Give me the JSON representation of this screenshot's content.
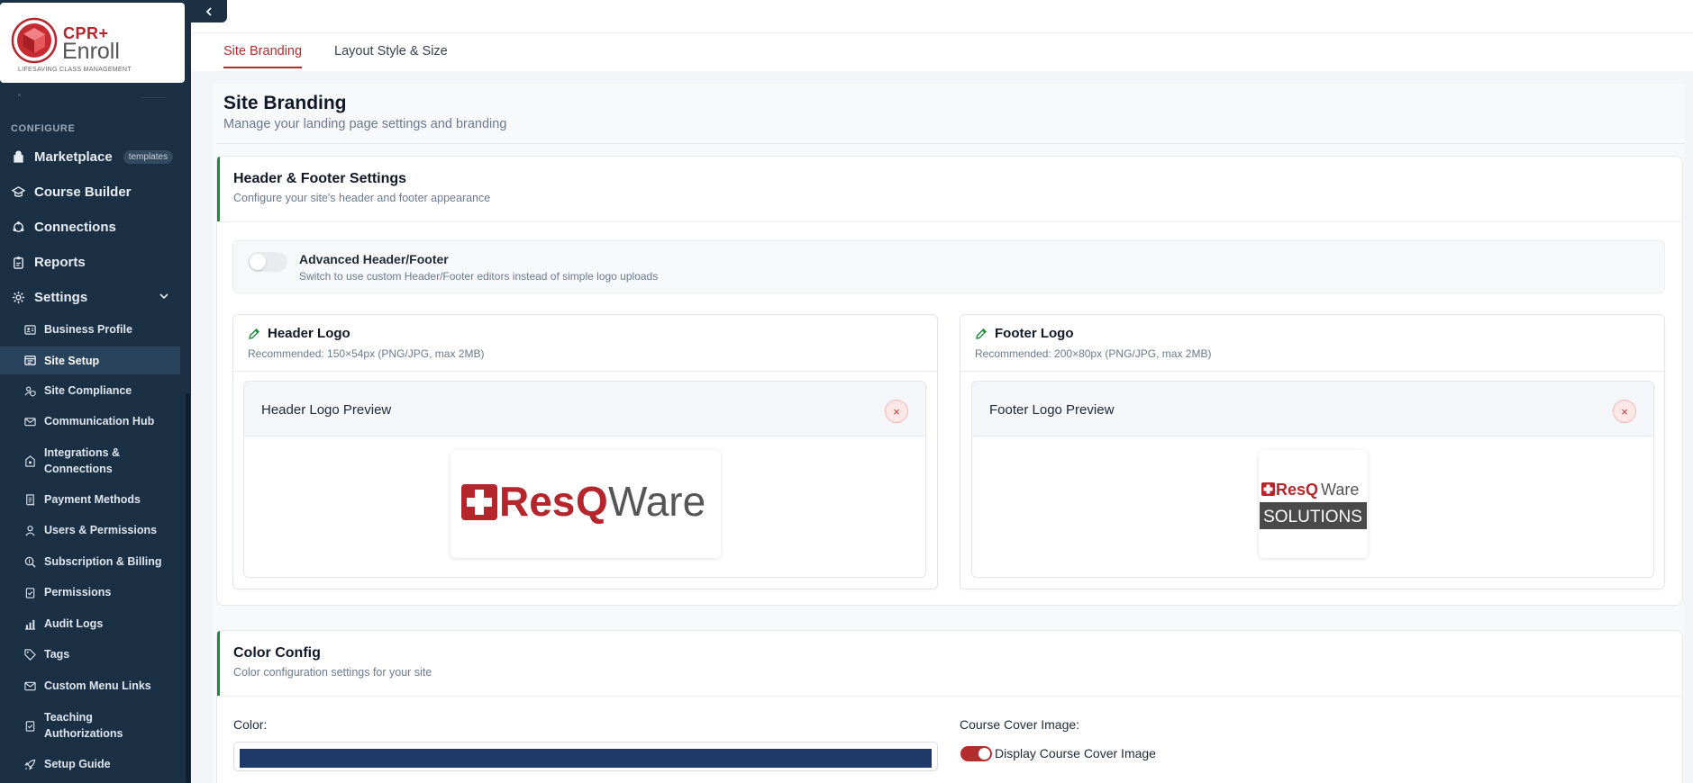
{
  "brand": {
    "name_top": "CPR+",
    "name_bottom": "Enroll",
    "tagline": "LIFESAVING CLASS MANAGEMENT"
  },
  "sidebar": {
    "section_label": "CONFIGURE",
    "top_items": [
      {
        "label": "Marketplace",
        "icon": "shop-icon",
        "badge": "templates"
      },
      {
        "label": "Course Builder",
        "icon": "graduation-cap-icon"
      },
      {
        "label": "Connections",
        "icon": "connections-icon"
      },
      {
        "label": "Reports",
        "icon": "clipboard-icon"
      },
      {
        "label": "Settings",
        "icon": "gear-icon"
      }
    ],
    "sub_items": [
      {
        "label": "Business Profile",
        "icon": "id-card-icon"
      },
      {
        "label": "Site Setup",
        "icon": "layout-icon"
      },
      {
        "label": "Site Compliance",
        "icon": "user-shield-icon"
      },
      {
        "label": "Communication Hub",
        "icon": "envelope-icon"
      },
      {
        "label": "Integrations & Connections",
        "icon": "network-icon"
      },
      {
        "label": "Payment Methods",
        "icon": "receipt-icon"
      },
      {
        "label": "Users & Permissions",
        "icon": "user-icon"
      },
      {
        "label": "Subscription & Billing",
        "icon": "magnify-dollar-icon"
      },
      {
        "label": "Permissions",
        "icon": "clipboard-check-icon"
      },
      {
        "label": "Audit Logs",
        "icon": "bar-chart-icon"
      },
      {
        "label": "Tags",
        "icon": "tag-icon"
      },
      {
        "label": "Custom Menu Links",
        "icon": "link-icon"
      },
      {
        "label": "Teaching Authorizations",
        "icon": "clipboard-check-icon"
      },
      {
        "label": "Setup Guide",
        "icon": "rocket-icon"
      }
    ]
  },
  "tabs": [
    {
      "label": "Site Branding",
      "active": true
    },
    {
      "label": "Layout Style & Size",
      "active": false
    }
  ],
  "page": {
    "title": "Site Branding",
    "subtitle": "Manage your landing page settings and branding"
  },
  "header_footer": {
    "title": "Header & Footer Settings",
    "subtitle": "Configure your site's header and footer appearance",
    "advanced_title": "Advanced Header/Footer",
    "advanced_sub": "Switch to use custom Header/Footer editors instead of simple logo uploads",
    "advanced_enabled": false,
    "header_logo": {
      "title": "Header Logo",
      "recommend": "Recommended: 150×54px (PNG/JPG, max 2MB)",
      "preview_title": "Header Logo Preview",
      "remove_symbol": "×",
      "image": {
        "brand_res": "Res",
        "brand_q": "Q",
        "brand_ware": "Ware"
      }
    },
    "footer_logo": {
      "title": "Footer Logo",
      "recommend": "Recommended: 200×80px (PNG/JPG, max 2MB)",
      "preview_title": "Footer Logo Preview",
      "remove_symbol": "×",
      "image": {
        "brand_resq": "ResQ",
        "brand_ware": "Ware",
        "brand_solutions": "SOLUTIONS"
      }
    }
  },
  "color_config": {
    "title": "Color Config",
    "subtitle": "Color configuration settings for your site",
    "color_label": "Color:",
    "color_value": "#1f3a6a",
    "cover_label": "Course Cover Image:",
    "display_cover_label": "Display Course Cover Image",
    "display_cover_enabled": true
  },
  "colors": {
    "sidebar_bg": "#1b2f45",
    "accent_red": "#b32d2e",
    "accent_green": "#1c8c3a"
  }
}
